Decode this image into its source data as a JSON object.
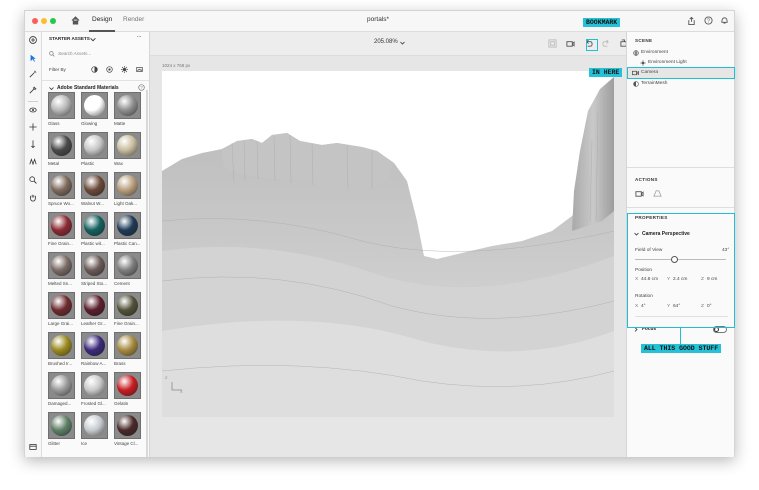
{
  "window": {
    "title": "portals*"
  },
  "titlebar": {
    "tabs": [
      "Design",
      "Render"
    ],
    "active_tab": "Design"
  },
  "left_tools": [
    "add-icon",
    "select-icon",
    "magic-wand-icon",
    "eyedropper-icon",
    "orbit-icon",
    "pan-icon",
    "dolly-icon",
    "walk-icon",
    "zoom-icon",
    "hand-icon"
  ],
  "assets": {
    "header": "STARTER ASSETS",
    "search_placeholder": "Search Assets...",
    "filter_label": "Filter By",
    "section_title": "Adobe Standard Materials",
    "materials": [
      {
        "label": "Glass",
        "color": "#b9b9b9"
      },
      {
        "label": "Glowing",
        "color": "#ffffff"
      },
      {
        "label": "Matte",
        "color": "#8f8f8f"
      },
      {
        "label": "Metal",
        "color": "#4a4a4a"
      },
      {
        "label": "Plastic",
        "color": "#c7c7c7"
      },
      {
        "label": "Wax",
        "color": "#c9bd9f"
      },
      {
        "label": "Spruce Wo...",
        "color": "#7d6a5c"
      },
      {
        "label": "Walnut W...",
        "color": "#6b4a3a"
      },
      {
        "label": "Light Oak...",
        "color": "#b99f7d"
      },
      {
        "label": "Fine Grain...",
        "color": "#8c2a33"
      },
      {
        "label": "Plastic wit...",
        "color": "#14615f"
      },
      {
        "label": "Plastic Can...",
        "color": "#1f3b57"
      },
      {
        "label": "Melted Sn...",
        "color": "#7a6b65"
      },
      {
        "label": "Striped Sto...",
        "color": "#6b5b57"
      },
      {
        "label": "Cement",
        "color": "#7f7f7f"
      },
      {
        "label": "Large Grai...",
        "color": "#6d2b2e"
      },
      {
        "label": "Leather Gr...",
        "color": "#5a1e2c"
      },
      {
        "label": "Fine Grain...",
        "color": "#53533a"
      },
      {
        "label": "Brushed Ir...",
        "color": "#9b8a1f"
      },
      {
        "label": "Rainbow A...",
        "color": "#3c2a7a"
      },
      {
        "label": "Brass",
        "color": "#a68a3f"
      },
      {
        "label": "Damaged...",
        "color": "#9a9a9a"
      },
      {
        "label": "Frosted Gl...",
        "color": "#c9c9c9"
      },
      {
        "label": "Gelatin",
        "color": "#c81d22"
      },
      {
        "label": "Glitter",
        "color": "#5f7f66"
      },
      {
        "label": "Ice",
        "color": "#c8ccd0"
      },
      {
        "label": "Vintage Cl...",
        "color": "#4a2a2a"
      }
    ]
  },
  "canvas": {
    "zoom": "205.08%",
    "doc_size": "1024 x 768 px",
    "axis_z": "Z",
    "axis_x": "X"
  },
  "scene": {
    "title": "SCENE",
    "items": [
      {
        "label": "Environment",
        "icon": "globe-icon",
        "selected": false
      },
      {
        "label": "Environment Light",
        "icon": "light-icon",
        "selected": false
      },
      {
        "label": "Camera",
        "icon": "camera-icon",
        "selected": true
      },
      {
        "label": "TerrainMesh",
        "icon": "mesh-icon",
        "selected": false
      }
    ]
  },
  "actions": {
    "title": "ACTIONS"
  },
  "properties": {
    "title": "PROPERTIES",
    "group_title": "Camera Perspective",
    "fov_label": "Field of View",
    "fov_value": "43°",
    "fov_fraction": 0.43,
    "position_label": "Position",
    "position": {
      "x": "44.8 cm",
      "y": "2.4 cm",
      "z": "9 cm"
    },
    "rotation_label": "Rotation",
    "rotation": {
      "x": "4°",
      "y": "64°",
      "z": "0°"
    },
    "axis_x": "X",
    "axis_y": "Y",
    "axis_z": "Z",
    "focus_label": "Focus"
  },
  "annotations": {
    "bookmark": "BOOKMARK",
    "in_here": "IN HERE",
    "good_stuff": "ALL THIS GOOD STUFF"
  },
  "colors": {
    "highlight": "#25c1d6",
    "traffic_red": "#fc5f57",
    "traffic_yellow": "#fdbc2e",
    "traffic_green": "#28c840"
  }
}
